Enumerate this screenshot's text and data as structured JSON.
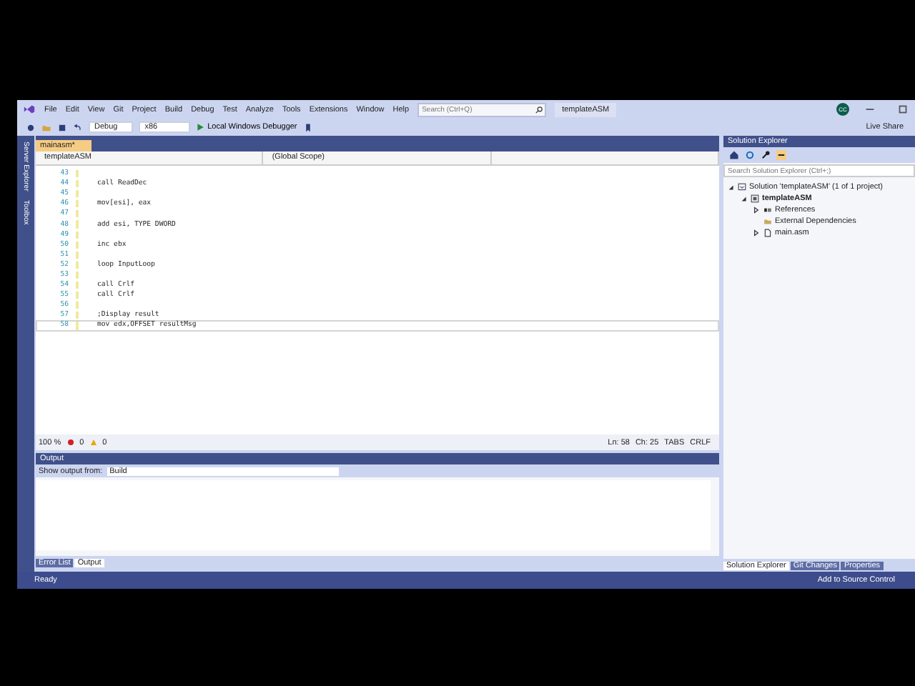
{
  "menu": [
    "File",
    "Edit",
    "View",
    "Git",
    "Project",
    "Build",
    "Debug",
    "Test",
    "Analyze",
    "Tools",
    "Extensions",
    "Window",
    "Help"
  ],
  "search": {
    "placeholder": "Search (Ctrl+Q)"
  },
  "window": {
    "title": "templateASM",
    "avatar": "CC"
  },
  "toolbar": {
    "configuration": "Debug",
    "platform": "x86",
    "debugger": "Local Windows Debugger",
    "live_share": "Live Share"
  },
  "side_tabs": [
    "Server Explorer",
    "Toolbox"
  ],
  "editor": {
    "tab": {
      "label": "mainasm*",
      "selected": true
    },
    "project": "templateASM",
    "scope": "(Global Scope)",
    "lines": [
      {
        "number": "43",
        "current": false
      },
      {
        "number": "44",
        "text": "call ReadDec",
        "current": false
      },
      {
        "number": "45",
        "current": false
      },
      {
        "number": "46",
        "text": "mov[esi], eax",
        "current": false
      },
      {
        "number": "47",
        "current": false
      },
      {
        "number": "48",
        "text": "add esi, TYPE DWORD",
        "current": false
      },
      {
        "number": "49",
        "current": false
      },
      {
        "number": "50",
        "text": "inc ebx",
        "current": false
      },
      {
        "number": "51",
        "current": false
      },
      {
        "number": "52",
        "text": "loop InputLoop",
        "current": false
      },
      {
        "number": "53",
        "current": false
      },
      {
        "number": "54",
        "text": "call Crlf",
        "current": false
      },
      {
        "number": "55",
        "text": "call Crlf",
        "current": false
      },
      {
        "number": "56",
        "current": false
      },
      {
        "number": "57",
        "text": ";Display result",
        "current": false
      },
      {
        "number": "58",
        "text": "mov edx,OFFSET resultMsg",
        "current": true
      }
    ],
    "status": {
      "zoom": "100 %",
      "errors": "0",
      "warnings": "0",
      "line": "Ln: 58",
      "column": "Ch: 25",
      "indent": "TABS",
      "line_endings": "CRLF"
    }
  },
  "output": {
    "title": "Output",
    "label": "Show output from:",
    "source": "Build"
  },
  "bottom_tabs": [
    {
      "label": "Error List",
      "selected": false
    },
    {
      "label": "Output",
      "selected": true
    }
  ],
  "solution_explorer": {
    "title": "Solution Explorer",
    "search": {
      "placeholder": "Search Solution Explorer (Ctrl+;)"
    },
    "tree": [
      {
        "label": "Solution 'templateASM' (1 of 1 project)",
        "kind": "solution",
        "expanded": true,
        "children": [
          {
            "label": "templateASM",
            "kind": "project",
            "expanded": true,
            "children": [
              {
                "label": "References",
                "kind": "references",
                "expanded": false
              },
              {
                "label": "External Dependencies",
                "kind": "folder"
              },
              {
                "label": "main.asm",
                "kind": "file",
                "expanded": false
              }
            ]
          }
        ]
      }
    ],
    "tabs": [
      {
        "label": "Solution Explorer",
        "selected": true
      },
      {
        "label": "Git Changes",
        "selected": false
      },
      {
        "label": "Properties",
        "selected": false
      }
    ]
  },
  "status_bar": {
    "message": "Ready",
    "source_control": "Add to Source Control"
  }
}
